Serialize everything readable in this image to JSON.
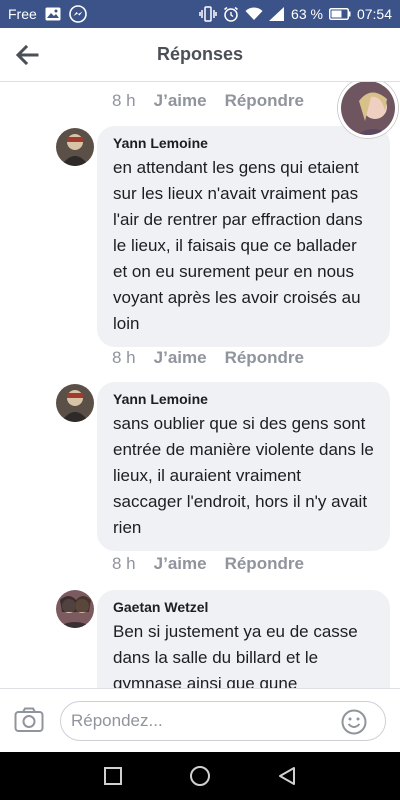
{
  "status_bar": {
    "carrier": "Free",
    "battery": "63 %",
    "time": "07:54",
    "icons": [
      "image-icon",
      "messenger-icon",
      "vibrate-icon",
      "alarm-icon",
      "wifi-icon",
      "signal-icon",
      "battery-icon"
    ]
  },
  "header": {
    "title": "Réponses",
    "back_icon": "arrow-left-icon"
  },
  "top_actions": {
    "time": "8 h",
    "like": "J’aime",
    "reply": "Répondre"
  },
  "comments": [
    {
      "author": "Yann Lemoine",
      "text": "en attendant les gens qui etaient sur les lieux n'avait vraiment pas l'air de rentrer par effraction dans le lieux, il faisais que ce ballader et on eu surement peur en nous voyant après les avoir croisés au loin",
      "time": "8 h",
      "like": "J’aime",
      "reply": "Répondre"
    },
    {
      "author": "Yann Lemoine",
      "text": "sans oublier que si des gens sont entrée de manière violente dans le lieux, il auraient vraiment saccager l'endroit, hors il n'y avait rien",
      "time": "8 h",
      "like": "J’aime",
      "reply": "Répondre"
    },
    {
      "author": "Gaetan Wetzel",
      "text": "Ben si justement ya eu de casse dans la salle du billard et le gymnase ainsi que gune"
    }
  ],
  "composer": {
    "placeholder": "Répondez...",
    "camera_icon": "camera-icon",
    "emoji_icon": "smiley-icon"
  },
  "nav": {
    "icons": [
      "recent-apps-icon",
      "home-icon",
      "back-triangle-icon"
    ]
  },
  "colors": {
    "status_bar": "#3b5388",
    "bubble": "#f0f1f4",
    "muted": "#90949c"
  }
}
